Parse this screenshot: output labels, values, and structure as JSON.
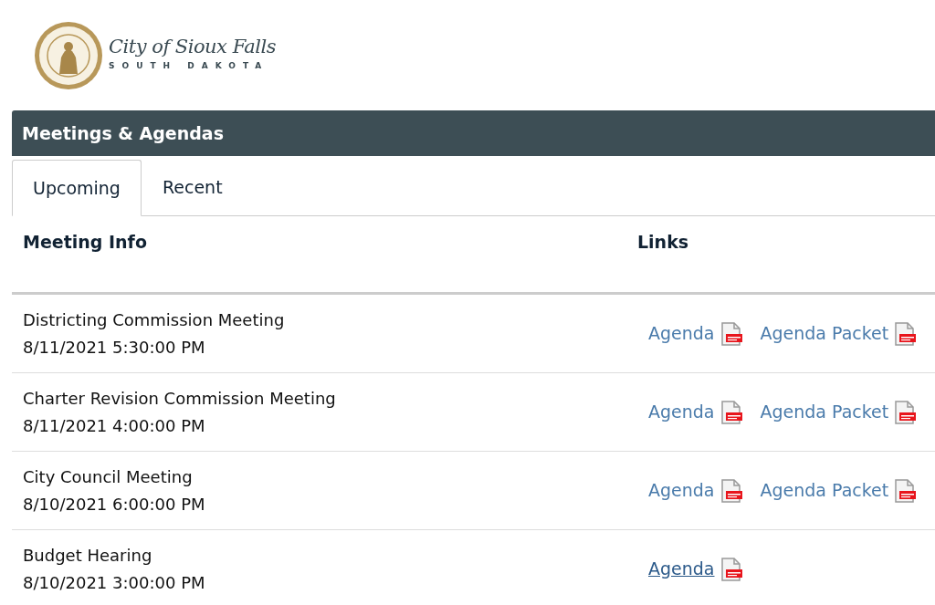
{
  "logo": {
    "name": "City of Sioux Falls",
    "subtitle": "SOUTH DAKOTA"
  },
  "panel": {
    "title": "Meetings & Agendas"
  },
  "tabs": [
    {
      "label": "Upcoming",
      "selected": true
    },
    {
      "label": "Recent",
      "selected": false
    }
  ],
  "table": {
    "columns": [
      "Meeting Info",
      "Links"
    ],
    "rows": [
      {
        "name": "Districting Commission Meeting",
        "datetime": "8/11/2021 5:30:00 PM",
        "links": [
          {
            "label": "Agenda",
            "hovered": false
          },
          {
            "label": "Agenda Packet",
            "hovered": false
          }
        ]
      },
      {
        "name": "Charter Revision Commission Meeting",
        "datetime": "8/11/2021 4:00:00 PM",
        "links": [
          {
            "label": "Agenda",
            "hovered": false
          },
          {
            "label": "Agenda Packet",
            "hovered": false
          }
        ]
      },
      {
        "name": "City Council Meeting",
        "datetime": "8/10/2021 6:00:00 PM",
        "links": [
          {
            "label": "Agenda",
            "hovered": false
          },
          {
            "label": "Agenda Packet",
            "hovered": false
          }
        ]
      },
      {
        "name": "Budget Hearing",
        "datetime": "8/10/2021 3:00:00 PM",
        "links": [
          {
            "label": "Agenda",
            "hovered": true
          }
        ]
      }
    ]
  }
}
